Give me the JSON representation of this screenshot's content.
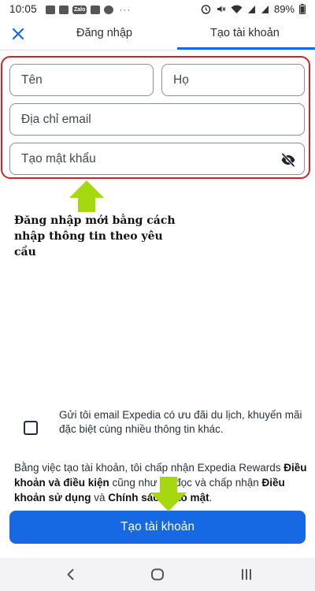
{
  "status_bar": {
    "time": "10:05",
    "battery": "89%",
    "icons_left": [
      "notification-icon",
      "mail-icon",
      "zalo-icon",
      "image-icon",
      "facebook-icon",
      "more-dots-icon"
    ],
    "zalo_label": "Zalo",
    "more": "···",
    "icons_right": [
      "alarm-icon",
      "mute-icon",
      "wifi-icon",
      "signal-icon",
      "signal-icon",
      "battery-icon"
    ]
  },
  "header": {
    "tab_login": "Đăng nhập",
    "tab_signup": "Tạo tài khoản",
    "active_tab": "signup",
    "close_icon": "close-icon"
  },
  "form": {
    "first_name_placeholder": "Tên",
    "last_name_placeholder": "Họ",
    "email_placeholder": "Địa chỉ email",
    "password_placeholder": "Tạo mật khẩu",
    "first_name_value": "",
    "last_name_value": "",
    "email_value": "",
    "password_value": "",
    "password_toggle_icon": "eye-off-icon"
  },
  "annotation": {
    "text": "Đăng nhập mới bằng cách nhập thông tin theo yêu cầu"
  },
  "newsletter": {
    "checked": false,
    "label": "Gửi tôi email Expedia có ưu đãi du lịch, khuyến mãi đặc biệt cùng nhiều thông tin khác."
  },
  "terms": {
    "part1": "Bằng việc tạo tài khoản, tôi chấp nhận Expedia Rewards ",
    "link1": "Điều khoản và điều kiện",
    "part2": " cũng như đã đọc và chấp nhận ",
    "link2": "Điều khoản sử dụng",
    "part3": " và ",
    "link3": "Chính sách bảo mật",
    "part4": "."
  },
  "primary_button": {
    "label": "Tạo tài khoản"
  },
  "nav_bar": {
    "icons": [
      "back-icon",
      "home-icon",
      "recent-apps-icon"
    ]
  },
  "colors": {
    "accent": "#1668e3",
    "highlight_frame": "#d0242b",
    "annotation_arrow": "#a6d80f"
  }
}
